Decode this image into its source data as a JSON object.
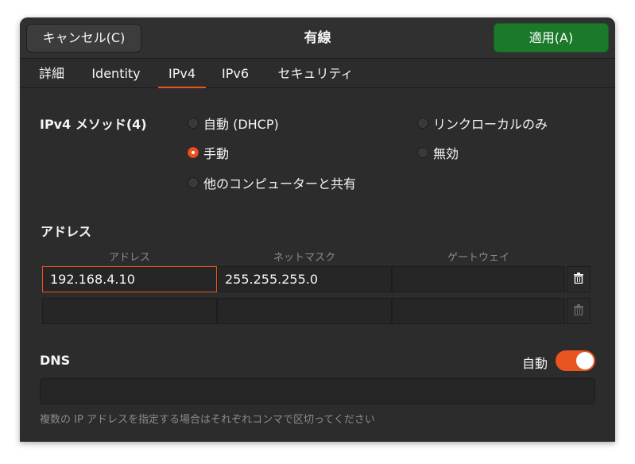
{
  "header": {
    "cancel_label": "キャンセル(C)",
    "title": "有線",
    "apply_label": "適用(A)"
  },
  "tabs": [
    {
      "label": "詳細"
    },
    {
      "label": "Identity"
    },
    {
      "label": "IPv4",
      "active": true
    },
    {
      "label": "IPv6"
    },
    {
      "label": "セキュリティ"
    }
  ],
  "ipv4_method": {
    "label": "IPv4 メソッド(4)",
    "options": [
      {
        "label": "自動 (DHCP)",
        "checked": false
      },
      {
        "label": "リンクローカルのみ",
        "checked": false
      },
      {
        "label": "手動",
        "checked": true
      },
      {
        "label": "無効",
        "checked": false
      },
      {
        "label": "他のコンピューターと共有",
        "checked": false
      }
    ]
  },
  "addresses": {
    "label": "アドレス",
    "columns": [
      "アドレス",
      "ネットマスク",
      "ゲートウェイ"
    ],
    "rows": [
      {
        "address": "192.168.4.10",
        "netmask": "255.255.255.0",
        "gateway": ""
      },
      {
        "address": "",
        "netmask": "",
        "gateway": ""
      }
    ]
  },
  "dns": {
    "label": "DNS",
    "auto_label": "自動",
    "auto_enabled": true,
    "value": "",
    "hint": "複数の IP アドレスを指定する場合はそれぞれコンマで区切ってください"
  },
  "colors": {
    "accent": "#e95420",
    "apply_button": "#1a7a2a",
    "background": "#2c2c2c"
  }
}
